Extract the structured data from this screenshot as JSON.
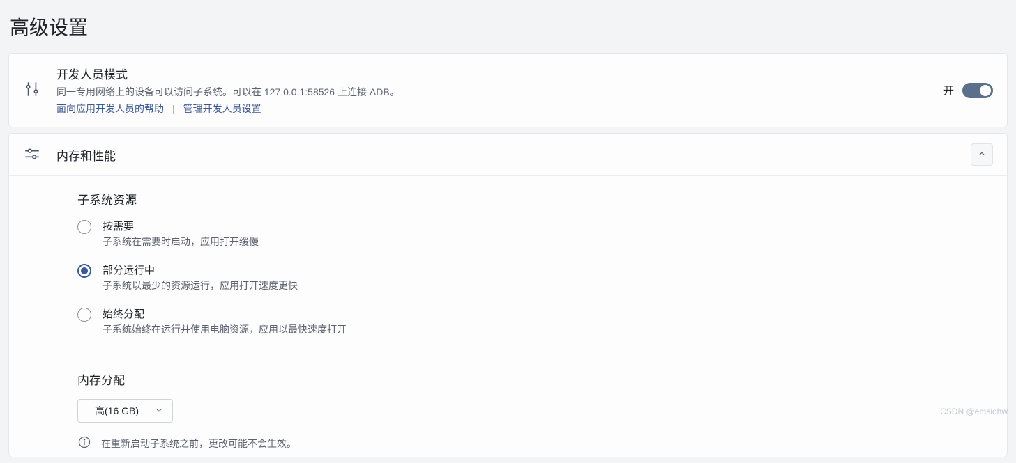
{
  "page_title": "高级设置",
  "developer": {
    "title": "开发人员模式",
    "description": "同一专用网络上的设备可以访问子系统。可以在 127.0.0.1:58526 上连接 ADB。",
    "help_link": "面向应用开发人员的帮助",
    "manage_link": "管理开发人员设置",
    "toggle_state_label": "开"
  },
  "memory_perf": {
    "header": "内存和性能",
    "resources_label": "子系统资源",
    "options": [
      {
        "title": "按需要",
        "desc": "子系统在需要时启动，应用打开缓慢",
        "selected": false
      },
      {
        "title": "部分运行中",
        "desc": "子系统以最少的资源运行，应用打开速度更快",
        "selected": true
      },
      {
        "title": "始终分配",
        "desc": "子系统始终在运行并使用电脑资源，应用以最快速度打开",
        "selected": false
      }
    ],
    "alloc_label": "内存分配",
    "dropdown_value": "高(16 GB)",
    "info_text": "在重新启动子系统之前，更改可能不会生效。"
  },
  "watermark": "CSDN @emsiohw"
}
